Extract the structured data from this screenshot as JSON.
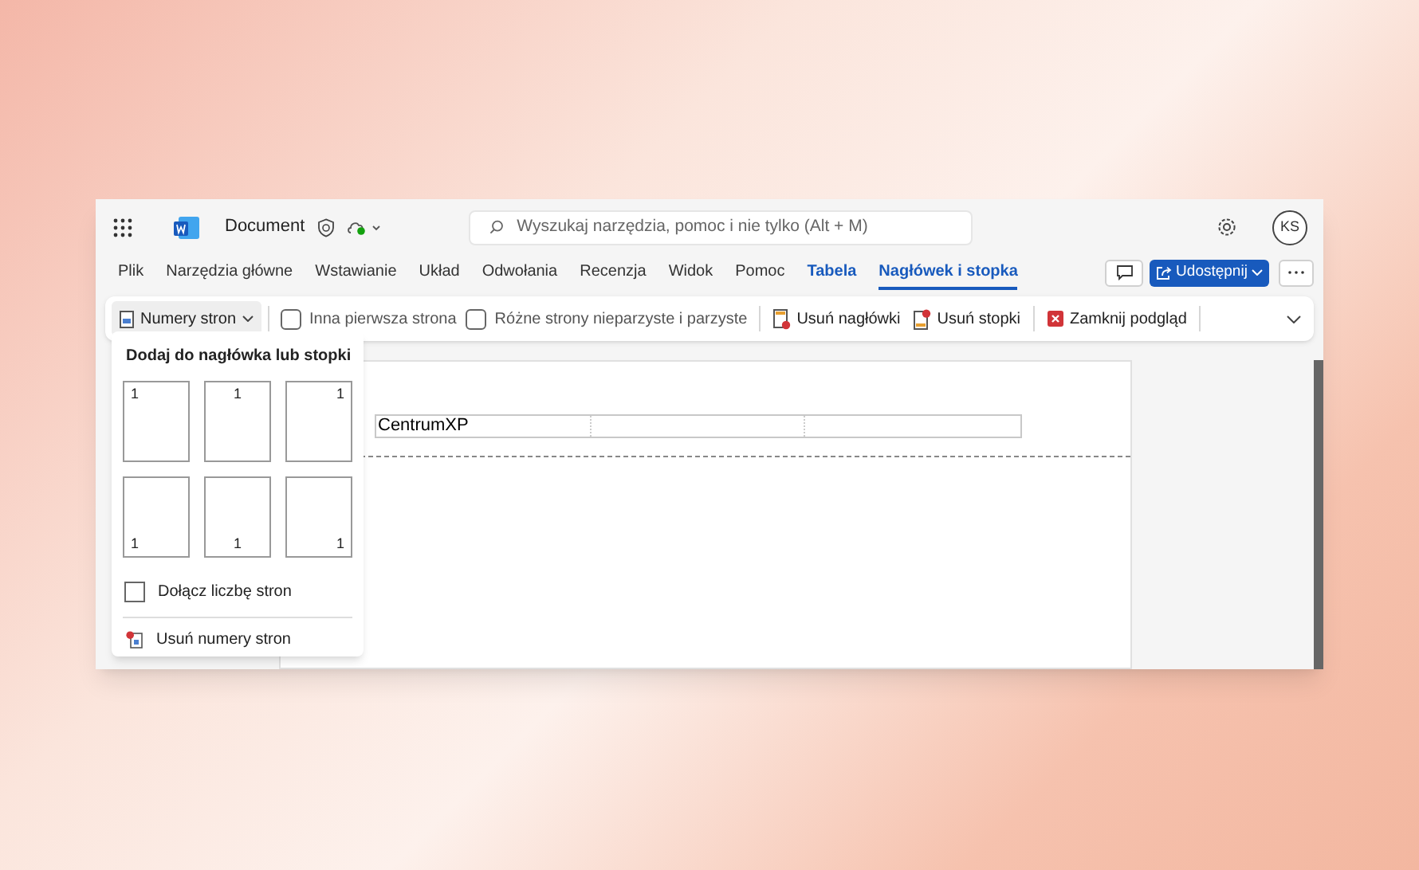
{
  "title_bar": {
    "document_title": "Document",
    "search": {
      "placeholder": "Wyszukaj narzędzia, pomoc i nie tylko (Alt + M)"
    },
    "avatar": "KS"
  },
  "menu_tabs": [
    {
      "label": "Plik",
      "selected": false,
      "contextual": false
    },
    {
      "label": "Narzędzia główne",
      "selected": false,
      "contextual": false
    },
    {
      "label": "Wstawianie",
      "selected": false,
      "contextual": false
    },
    {
      "label": "Układ",
      "selected": false,
      "contextual": false
    },
    {
      "label": "Odwołania",
      "selected": false,
      "contextual": false
    },
    {
      "label": "Recenzja",
      "selected": false,
      "contextual": false
    },
    {
      "label": "Widok",
      "selected": false,
      "contextual": false
    },
    {
      "label": "Pomoc",
      "selected": false,
      "contextual": false
    },
    {
      "label": "Tabela",
      "selected": false,
      "contextual": true
    },
    {
      "label": "Nagłówek i stopka",
      "selected": true,
      "contextual": true
    }
  ],
  "share_button": "Udostępnij",
  "ribbon": [
    {
      "kind": "dropdown",
      "label": "Numery stron",
      "expanded": true
    },
    {
      "kind": "checkbox",
      "label": "Inna pierwsza strona",
      "checked": false
    },
    {
      "kind": "checkbox",
      "label": "Różne strony nieparzyste i parzyste",
      "checked": false
    },
    {
      "kind": "button",
      "label": "Usuń nagłówki"
    },
    {
      "kind": "button",
      "label": "Usuń stopki"
    },
    {
      "kind": "button",
      "label": "Zamknij podgląd"
    }
  ],
  "page_numbers_menu": {
    "title": "Dodaj do nagłówka lub stopki",
    "positions": [
      {
        "label": "1",
        "kind": "top"
      },
      {
        "label": "1",
        "kind": "top"
      },
      {
        "label": "1",
        "kind": "top"
      },
      {
        "label": "1",
        "kind": "bottom"
      },
      {
        "label": "1",
        "kind": "bottom"
      },
      {
        "label": "1",
        "kind": "bottom"
      }
    ],
    "include_page_count": {
      "label": "Dołącz liczbę stron",
      "checked": false
    },
    "remove": "Usuń numery stron"
  },
  "document": {
    "header_text": "CentrumXP"
  }
}
